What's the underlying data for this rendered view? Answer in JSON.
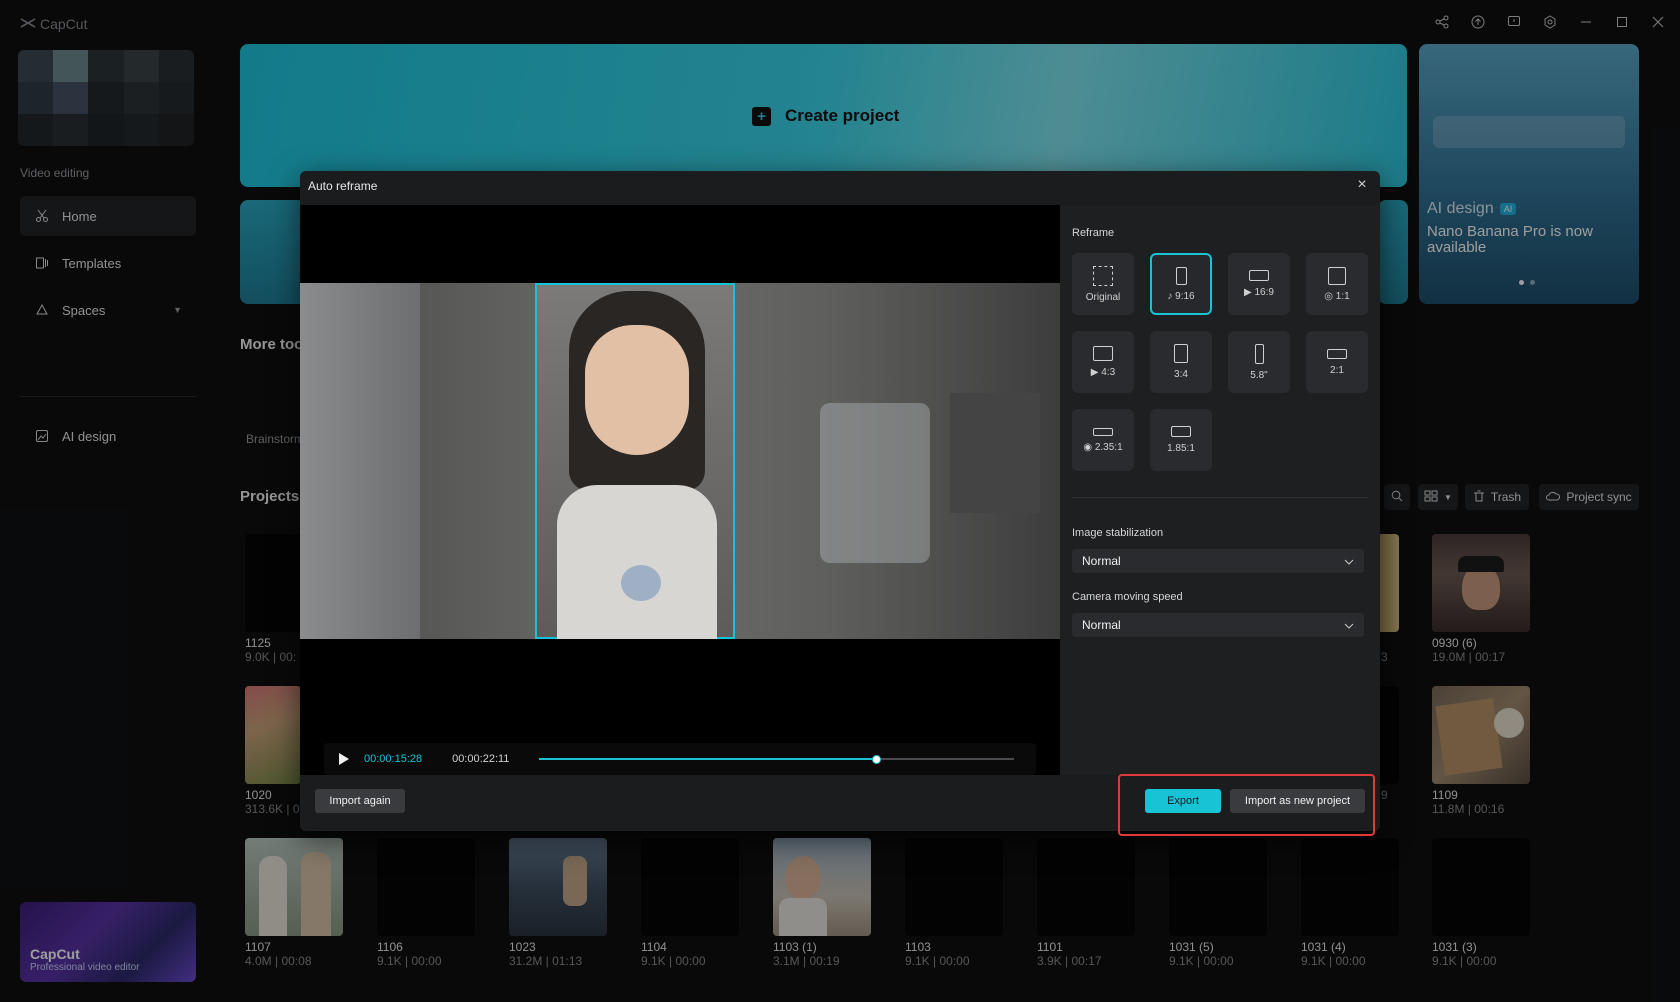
{
  "app": {
    "title": "CapCut"
  },
  "window": {
    "icons": [
      "share-icon",
      "upload-icon",
      "feedback-icon",
      "settings-icon",
      "minimize-icon",
      "maximize-icon",
      "close-icon"
    ]
  },
  "sidebar": {
    "section_label": "Video editing",
    "items": [
      {
        "label": "Home",
        "icon": "scissors-icon"
      },
      {
        "label": "Templates",
        "icon": "templates-icon"
      },
      {
        "label": "Spaces",
        "icon": "cloud-icon"
      },
      {
        "label": "AI design",
        "icon": "ai-design-icon"
      }
    ],
    "promo": {
      "title": "CapCut",
      "subtitle": "Professional video editor"
    }
  },
  "hero": {
    "create_label": "Create project"
  },
  "ai_card": {
    "label": "AI design",
    "badge": "AI",
    "message": "Nano Banana Pro is now available"
  },
  "more_tools": {
    "title": "More too",
    "item": "Brainstorm"
  },
  "projects": {
    "title": "Projects",
    "trash_label": "Trash",
    "sync_label": "Project sync",
    "items": [
      {
        "name": "1125",
        "meta": "9.0K | 00:"
      },
      {
        "name": "0930 (6)",
        "meta": "19.0M | 00:17"
      },
      {
        "name": "1020",
        "meta": "313.6K | 0"
      },
      {
        "name": "1109",
        "meta": "11.8M | 00:16"
      },
      {
        "name": "1107",
        "meta": "4.0M | 00:08"
      },
      {
        "name": "1106",
        "meta": "9.1K | 00:00"
      },
      {
        "name": "1023",
        "meta": "31.2M | 01:13"
      },
      {
        "name": "1104",
        "meta": "9.1K | 00:00"
      },
      {
        "name": "1103 (1)",
        "meta": "3.1M | 00:19"
      },
      {
        "name": "1103",
        "meta": "9.1K | 00:00"
      },
      {
        "name": "1101",
        "meta": "3.9K | 00:17"
      },
      {
        "name": "1031 (5)",
        "meta": "9.1K | 00:00"
      },
      {
        "name": "1031 (4)",
        "meta": "9.1K | 00:00"
      },
      {
        "name": "1031 (3)",
        "meta": "9.1K | 00:00"
      }
    ],
    "partial_names": [
      "3",
      "9"
    ]
  },
  "dialog": {
    "title": "Auto reframe",
    "player": {
      "current_time": "00:00:15:28",
      "total_time": "00:00:22:11",
      "progress": 0.71
    },
    "reframe_label": "Reframe",
    "ratios": [
      {
        "label": "Original",
        "icon": "dashed-frame-icon",
        "selected": false
      },
      {
        "label": "9:16",
        "icon": "tiktok-icon",
        "selected": true
      },
      {
        "label": "16:9",
        "icon": "youtube-icon",
        "selected": false
      },
      {
        "label": "1:1",
        "icon": "instagram-icon",
        "selected": false
      },
      {
        "label": "4:3",
        "icon": "youtube-icon",
        "selected": false
      },
      {
        "label": "3:4",
        "icon": "",
        "selected": false
      },
      {
        "label": "5.8\"",
        "icon": "",
        "selected": false
      },
      {
        "label": "2:1",
        "icon": "",
        "selected": false
      },
      {
        "label": "2.35:1",
        "icon": "film-icon",
        "selected": false
      },
      {
        "label": "1.85:1",
        "icon": "",
        "selected": false
      }
    ],
    "stabilization": {
      "label": "Image stabilization",
      "value": "Normal"
    },
    "camera_speed": {
      "label": "Camera moving speed",
      "value": "Normal"
    },
    "buttons": {
      "import_again": "Import again",
      "export": "Export",
      "import_new": "Import as new project"
    },
    "accent": "#19c3d6"
  }
}
